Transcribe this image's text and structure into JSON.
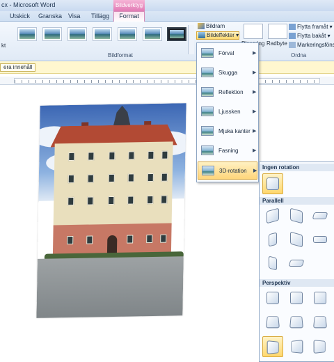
{
  "window": {
    "title": "cx - Microsoft Word",
    "contextual_tab_group": "Bildverktyg"
  },
  "tabs": [
    {
      "label": "Utskick"
    },
    {
      "label": "Granska"
    },
    {
      "label": "Visa"
    },
    {
      "label": "Tillägg"
    },
    {
      "label": "Format",
      "active": true
    }
  ],
  "ribbon": {
    "left_partial_label": "kt",
    "groups": {
      "bildformat": "Bildformat",
      "ordna": "Ordna"
    },
    "picture_effects": {
      "bildram": "Bildram",
      "bildeffekter": "Bildeffekter"
    },
    "arrange": {
      "placering": "Placering",
      "radbyte": "Radbyte",
      "flytta_fram": "Flytta framåt",
      "flytta_bak": "Flytta bakåt",
      "markeringsfonster": "Markeringsfönst"
    }
  },
  "message_bar": {
    "button_label": "era innehåll"
  },
  "effects_menu": {
    "items": [
      {
        "label": "Förval",
        "icon": "preset-icon"
      },
      {
        "label": "Skugga",
        "icon": "shadow-icon"
      },
      {
        "label": "Reflektion",
        "icon": "reflection-icon"
      },
      {
        "label": "Ljussken",
        "icon": "glow-icon"
      },
      {
        "label": "Mjuka kanter",
        "icon": "soft-edges-icon"
      },
      {
        "label": "Fasning",
        "icon": "bevel-icon"
      },
      {
        "label": "3D-rotation",
        "icon": "rotation-3d-icon",
        "highlighted": true
      }
    ]
  },
  "rotation_submenu": {
    "sections": {
      "none": "Ingen rotation",
      "parallel": "Parallell",
      "perspective": "Perspektiv"
    }
  },
  "colors": {
    "accent_highlight": "#ffd86e",
    "contextual_tab": "#e17bb4",
    "message_bar": "#fff7cf"
  }
}
